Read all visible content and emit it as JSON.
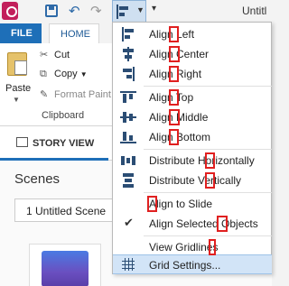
{
  "titlebar": {
    "app_icon": "app-logo",
    "save_icon": "save-icon",
    "undo_icon": "undo-icon",
    "redo_icon": "redo-icon",
    "align_icon": "align-left-icon",
    "title": "Untitl"
  },
  "ribbon": {
    "tabs": {
      "file": "FILE",
      "home": "HOME"
    },
    "paste_label": "Paste",
    "cut_label": "Cut",
    "copy_label": "Copy",
    "format_painter_label": "Format Paint",
    "clipboard_group": "Clipboard"
  },
  "story": {
    "view_label": "STORY VIEW"
  },
  "scenes": {
    "title": "Scenes",
    "selected": "1 Untitled Scene"
  },
  "menu": {
    "items": [
      {
        "label": "Align Left",
        "icon": "align-left-icon"
      },
      {
        "label": "Align Center",
        "icon": "align-center-icon"
      },
      {
        "label": "Align Right",
        "icon": "align-right-icon"
      },
      {
        "label": "Align Top",
        "icon": "align-top-icon"
      },
      {
        "label": "Align Middle",
        "icon": "align-middle-icon"
      },
      {
        "label": "Align Bottom",
        "icon": "align-bottom-icon"
      },
      {
        "label": "Distribute Horizontally",
        "icon": "distribute-horizontal-icon"
      },
      {
        "label": "Distribute Vertically",
        "icon": "distribute-vertical-icon"
      },
      {
        "label": "Align to Slide",
        "icon": ""
      },
      {
        "label": "Align Selected Objects",
        "icon": "check-icon"
      },
      {
        "label": "View Gridlines",
        "icon": ""
      },
      {
        "label": "Grid Settings...",
        "icon": "grid-icon"
      }
    ]
  },
  "colors": {
    "accent": "#1e6fb8",
    "highlight_box": "#e02020",
    "selected_row": "#d2e4f7"
  }
}
